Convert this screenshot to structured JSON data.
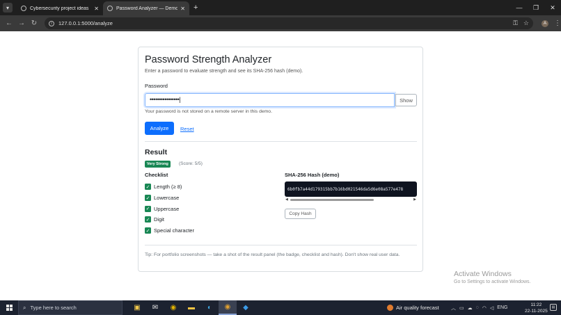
{
  "browser": {
    "tabs": [
      {
        "title": "Cybersecurity project ideas",
        "active": false
      },
      {
        "title": "Password Analyzer — Demo",
        "active": true
      }
    ],
    "url": "127.0.0.1:5000/analyze",
    "profile_initial": "A"
  },
  "card": {
    "title": "Password Strength Analyzer",
    "subtitle": "Enter a password to evaluate strength and see its SHA-256 hash (demo).",
    "password_label": "Password",
    "password_value": "••••••••••••••••|",
    "show_label": "Show",
    "privacy_note": "Your password is not stored on a remote server in this demo.",
    "analyze_label": "Analyze",
    "reset_label": "Reset"
  },
  "result": {
    "heading": "Result",
    "badge": "Very Strong",
    "score": "(Score: 5/5)",
    "badge_color": "#198754",
    "checklist_heading": "Checklist",
    "checklist": [
      {
        "label": "Length (≥ 8)",
        "checked": true
      },
      {
        "label": "Lowercase",
        "checked": true
      },
      {
        "label": "Uppercase",
        "checked": true
      },
      {
        "label": "Digit",
        "checked": true
      },
      {
        "label": "Special character",
        "checked": true
      }
    ],
    "hash_heading": "SHA-256 Hash (demo)",
    "hash_value": "6b0fb7a44d179315bb7b16bd021546da5d6e08a577e478",
    "copy_label": "Copy Hash"
  },
  "tip": "Tip: For portfolio screenshots — take a shot of the result panel (the badge, checklist and hash). Don't show real user data.",
  "watermark": {
    "line1": "Activate Windows",
    "line2": "Go to Settings to activate Windows."
  },
  "taskbar": {
    "search_placeholder": "Type here to search",
    "weather": "Air quality forecast",
    "lang": "ENG",
    "time": "11:22",
    "date": "22-11-2025"
  },
  "colors": {
    "primary": "#0d6efd",
    "success": "#198754",
    "hash_bg": "#0f1420"
  }
}
